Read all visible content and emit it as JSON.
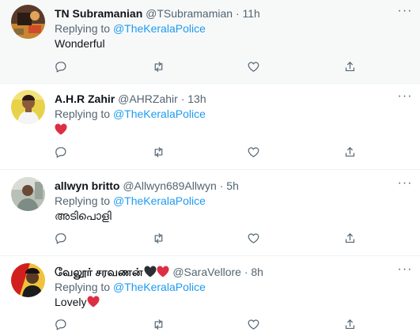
{
  "replies": [
    {
      "name": "TN Subramanian",
      "handle": "@TSubramamian",
      "separator": "·",
      "time": "11h",
      "replying_prefix": "Replying to",
      "replying_to": "@TheKeralaPolice",
      "text": "Wonderful",
      "heart_emoji": false,
      "more_icon": "more-horizontal-icon"
    },
    {
      "name": "A.H.R Zahir",
      "handle": "@AHRZahir",
      "separator": "·",
      "time": "13h",
      "replying_prefix": "Replying to",
      "replying_to": "@TheKeralaPolice",
      "text": "",
      "heart_emoji": true,
      "more_icon": "more-horizontal-icon"
    },
    {
      "name": "allwyn britto",
      "handle": "@Allwyn689Allwyn",
      "separator": "·",
      "time": "5h",
      "replying_prefix": "Replying to",
      "replying_to": "@TheKeralaPolice",
      "text": "അടിപൊളി",
      "heart_emoji": false,
      "more_icon": "more-horizontal-icon"
    },
    {
      "name": "வேலூர் சரவணன்",
      "name_emojis": [
        "black-heart",
        "red-heart"
      ],
      "handle": "@SaraVellore",
      "separator": "·",
      "time": "8h",
      "replying_prefix": "Replying to",
      "replying_to": "@TheKeralaPolice",
      "text": "Lovely",
      "heart_emoji": true,
      "more_icon": "more-horizontal-icon"
    }
  ],
  "action_icons": [
    "reply-icon",
    "retweet-icon",
    "like-icon",
    "share-icon"
  ],
  "colors": {
    "link": "#1d9bf0",
    "muted": "#536471",
    "text": "#0f1419",
    "highlight_background": "#f7f9f9",
    "heart": "#e0245e"
  }
}
